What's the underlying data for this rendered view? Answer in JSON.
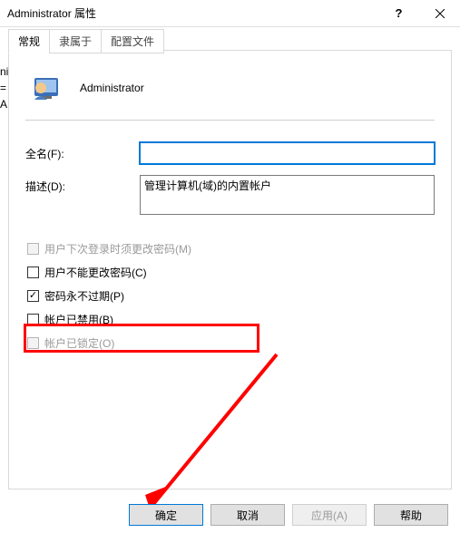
{
  "title": "Administrator 属性",
  "tabs": {
    "t0": "常规",
    "t1": "隶属于",
    "t2": "配置文件"
  },
  "user": {
    "name": "Administrator"
  },
  "labels": {
    "fullname": "全名(F):",
    "desc": "描述(D):"
  },
  "fields": {
    "fullname": "",
    "desc": "管理计算机(域)的内置帐户"
  },
  "checks": {
    "c0": "用户下次登录时须更改密码(M)",
    "c1": "用户不能更改密码(C)",
    "c2": "密码永不过期(P)",
    "c3": "帐户已禁用(B)",
    "c4": "帐户已锁定(O)"
  },
  "buttons": {
    "ok": "确定",
    "cancel": "取消",
    "apply": "应用(A)",
    "help": "帮助"
  },
  "side": "ni\n=\nA"
}
